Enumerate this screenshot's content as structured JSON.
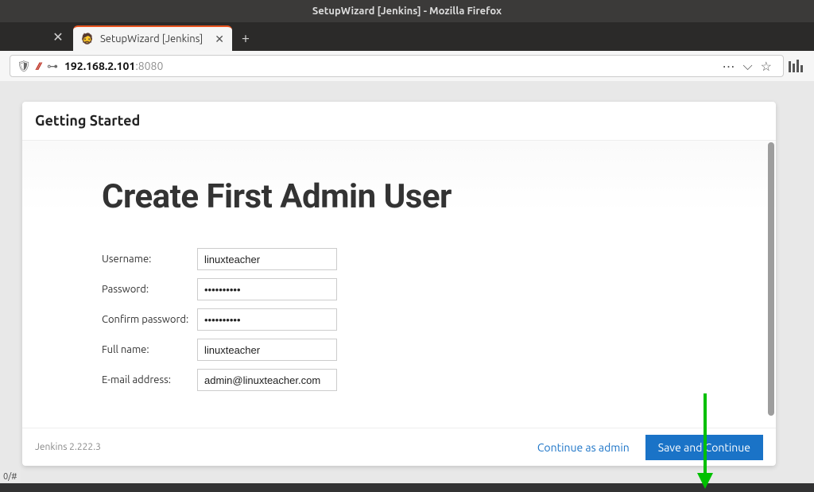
{
  "window": {
    "title": "SetupWizard [Jenkins] - Mozilla Firefox"
  },
  "tab": {
    "title": "SetupWizard [Jenkins]"
  },
  "address": {
    "host": "192.168.2.101",
    "port": ":8080"
  },
  "card": {
    "header": "Getting Started",
    "title": "Create First Admin User",
    "form": {
      "username_label": "Username:",
      "username_value": "linuxteacher",
      "password_label": "Password:",
      "password_value": "••••••••••",
      "confirm_label": "Confirm password:",
      "confirm_value": "••••••••••",
      "fullname_label": "Full name:",
      "fullname_value": "linuxteacher",
      "email_label": "E-mail address:",
      "email_value": "admin@linuxteacher.com"
    },
    "version": "Jenkins 2.222.3",
    "actions": {
      "continue_as_admin": "Continue as admin",
      "save_and_continue": "Save and Continue"
    }
  },
  "status": {
    "text": "0/#"
  }
}
